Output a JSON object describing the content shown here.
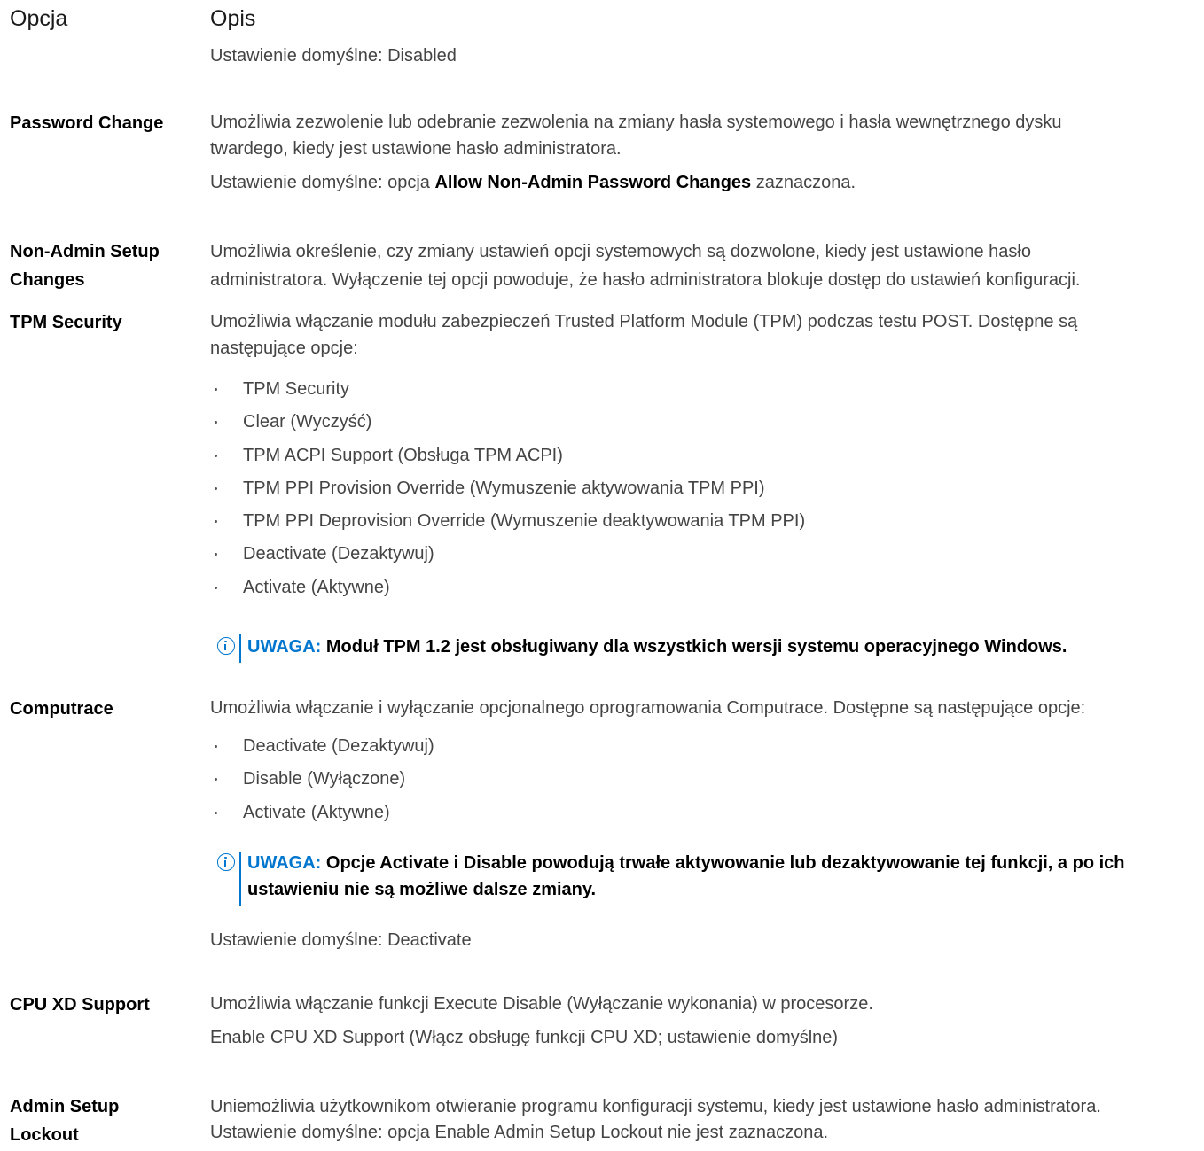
{
  "header": {
    "option": "Opcja",
    "description": "Opis"
  },
  "rows": [
    {
      "default": "Ustawienie domyślne: Disabled"
    },
    {
      "option": "Password Change",
      "desc_line1": "Umożliwia zezwolenie lub odebranie zezwolenia na zmiany hasła systemowego i hasła wewnętrznego dysku",
      "desc_line2": "twardego, kiedy jest ustawione hasło administratora.",
      "default_prefix": "Ustawienie domyślne: opcja",
      "default_bold": "Allow Non-Admin Password Changes",
      "default_suffix": "zaznaczona."
    },
    {
      "option_line1": "Non-Admin Setup",
      "option_line2": "Changes",
      "desc_line1": "Umożliwia określenie, czy zmiany ustawień opcji systemowych są dozwolone, kiedy jest ustawione hasło",
      "desc_line2": "administratora. Wyłączenie tej opcji powoduje, że hasło administratora blokuje dostęp do ustawień konfiguracji."
    },
    {
      "option": "TPM Security",
      "desc_line1": "Umożliwia włączanie modułu zabezpieczeń Trusted Platform Module (TPM) podczas testu POST. Dostępne są",
      "desc_line2": "następujące opcje:",
      "items": [
        "TPM Security",
        "Clear (Wyczyść)",
        "TPM ACPI Support (Obsługa TPM ACPI)",
        "TPM PPI Provision Override (Wymuszenie aktywowania TPM PPI)",
        "TPM PPI Deprovision Override (Wymuszenie deaktywowania TPM PPI)",
        "Deactivate (Dezaktywuj)",
        "Activate (Aktywne)"
      ],
      "note_label": "UWAGA:",
      "note_text": "Moduł TPM 1.2 jest obsługiwany dla wszystkich wersji systemu operacyjnego Windows."
    },
    {
      "option": "Computrace",
      "desc": "Umożliwia włączanie i wyłączanie opcjonalnego oprogramowania Computrace. Dostępne są następujące opcje:",
      "items": [
        "Deactivate (Dezaktywuj)",
        "Disable (Wyłączone)",
        "Activate (Aktywne)"
      ],
      "note_label": "UWAGA:",
      "note_line1": "Opcje Activate i Disable powodują trwałe aktywowanie lub dezaktywowanie tej funkcji, a po ich",
      "note_line2": "ustawieniu nie są możliwe dalsze zmiany.",
      "default": "Ustawienie domyślne: Deactivate"
    },
    {
      "option": "CPU XD Support",
      "desc": "Umożliwia włączanie funkcji Execute Disable (Wyłączanie wykonania) w procesorze.",
      "default": "Enable CPU XD Support (Włącz obsługę funkcji CPU XD; ustawienie domyślne)"
    },
    {
      "option_line1": "Admin Setup",
      "option_line2": "Lockout",
      "desc": "Uniemożliwia użytkownikom otwieranie programu konfiguracji systemu, kiedy jest ustawione hasło administratora.",
      "default": "Ustawienie domyślne: opcja Enable Admin Setup Lockout nie jest zaznaczona."
    }
  ]
}
